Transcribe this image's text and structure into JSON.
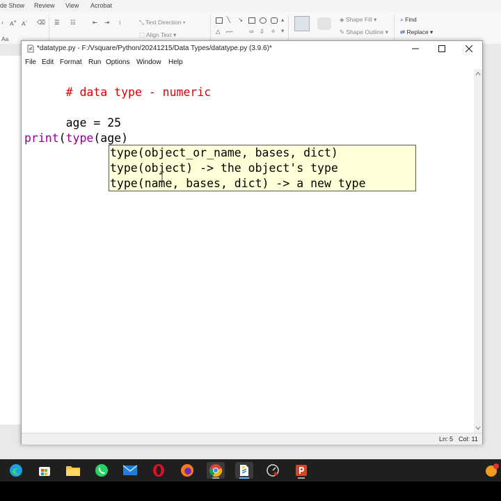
{
  "ribbon": {
    "tabs": [
      "de Show",
      "Review",
      "View",
      "Acrobat"
    ],
    "text_direction": "Text Direction",
    "align_text": "Align Text",
    "shape_fill": "Shape Fill",
    "shape_outline": "Shape Outline",
    "find": "Find",
    "replace": "Replace"
  },
  "editor": {
    "title": "*datatype.py - F:/Vsquare/Python/20241215/Data Types/datatype.py (3.9.6)*",
    "menu": [
      "File",
      "Edit",
      "Format",
      "Run",
      "Options",
      "Window",
      "Help"
    ],
    "code": {
      "line1": "# data type - numeric",
      "line3": "age = 25",
      "line5_builtin": "print",
      "line5_rest1": "(",
      "line5_builtin2": "type",
      "line5_rest2": "(age)"
    },
    "calltip": [
      "type(object_or_name, bases, dict)",
      "type(object) -> the object's type",
      "type(name, bases, dict) -> a new type"
    ],
    "status": {
      "line": "Ln: 5",
      "col": "Col: 11"
    }
  },
  "colors": {
    "comment": "#dd0000",
    "builtin": "#900090",
    "calltip_bg": "#ffffd8",
    "taskbar": "#1f1f1f"
  },
  "taskbar_icons": [
    "edge-icon",
    "store-icon",
    "file-explorer-icon",
    "whatsapp-icon",
    "mail-icon",
    "opera-icon",
    "firefox-icon",
    "chrome-icon",
    "idle-editor-icon",
    "speedometer-icon",
    "powerpoint-icon",
    "profile-icon"
  ]
}
